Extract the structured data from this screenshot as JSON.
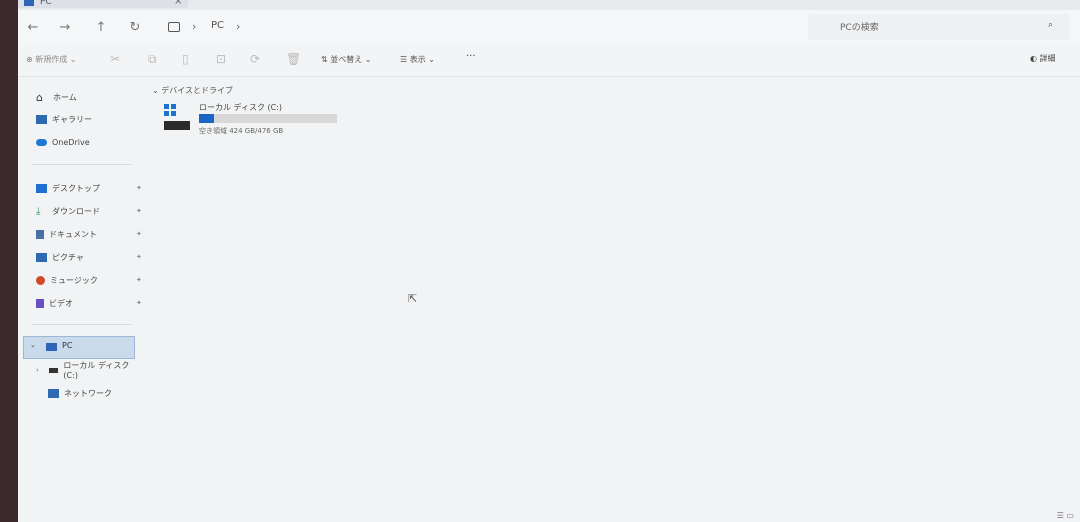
{
  "window": {
    "title": "PC",
    "close_glyph": "×"
  },
  "nav": {
    "back": "←",
    "forward": "→",
    "up": "↑",
    "refresh": "↻",
    "breadcrumb_sep": "›",
    "breadcrumb": "PC",
    "breadcrumb_trail": "›"
  },
  "search": {
    "placeholder": "PCの検索",
    "icon": "⌕"
  },
  "toolbar": {
    "new_label": "新規作成",
    "sort_label": "並べ替え",
    "view_label": "表示",
    "more": "···",
    "details_label": "詳細",
    "icons": [
      "cut-icon",
      "copy-icon",
      "paste-icon",
      "rename-icon",
      "share-icon",
      "delete-icon"
    ]
  },
  "sidebar": {
    "quick": [
      {
        "label": "ホーム",
        "icon": "home-icon"
      },
      {
        "label": "ギャラリー",
        "icon": "gallery-icon"
      },
      {
        "label": "OneDrive",
        "icon": "cloud-icon"
      }
    ],
    "pinned": [
      {
        "label": "デスクトップ",
        "icon": "desktop-icon",
        "color": "#1f6fd1"
      },
      {
        "label": "ダウンロード",
        "icon": "download-icon",
        "color": "#2f8f5f"
      },
      {
        "label": "ドキュメント",
        "icon": "document-icon",
        "color": "#4a6fa5"
      },
      {
        "label": "ピクチャ",
        "icon": "picture-icon",
        "color": "#2f6ab0"
      },
      {
        "label": "ミュージック",
        "icon": "music-icon",
        "color": "#d04a2a"
      },
      {
        "label": "ビデオ",
        "icon": "video-icon",
        "color": "#6a4fc0"
      }
    ],
    "pin_glyph": "📌",
    "tree": {
      "pc": "PC",
      "local_disk": "ローカル ディスク (C:)",
      "network": "ネットワーク"
    }
  },
  "main": {
    "group": "デバイスとドライブ",
    "drive": {
      "name": "ローカル ディスク (C:)",
      "free_text": "空き領域 424 GB/476 GB",
      "used_fraction": 0.11
    }
  },
  "colors": {
    "accent": "#1b66c5",
    "selection": "#c9dbeb"
  }
}
